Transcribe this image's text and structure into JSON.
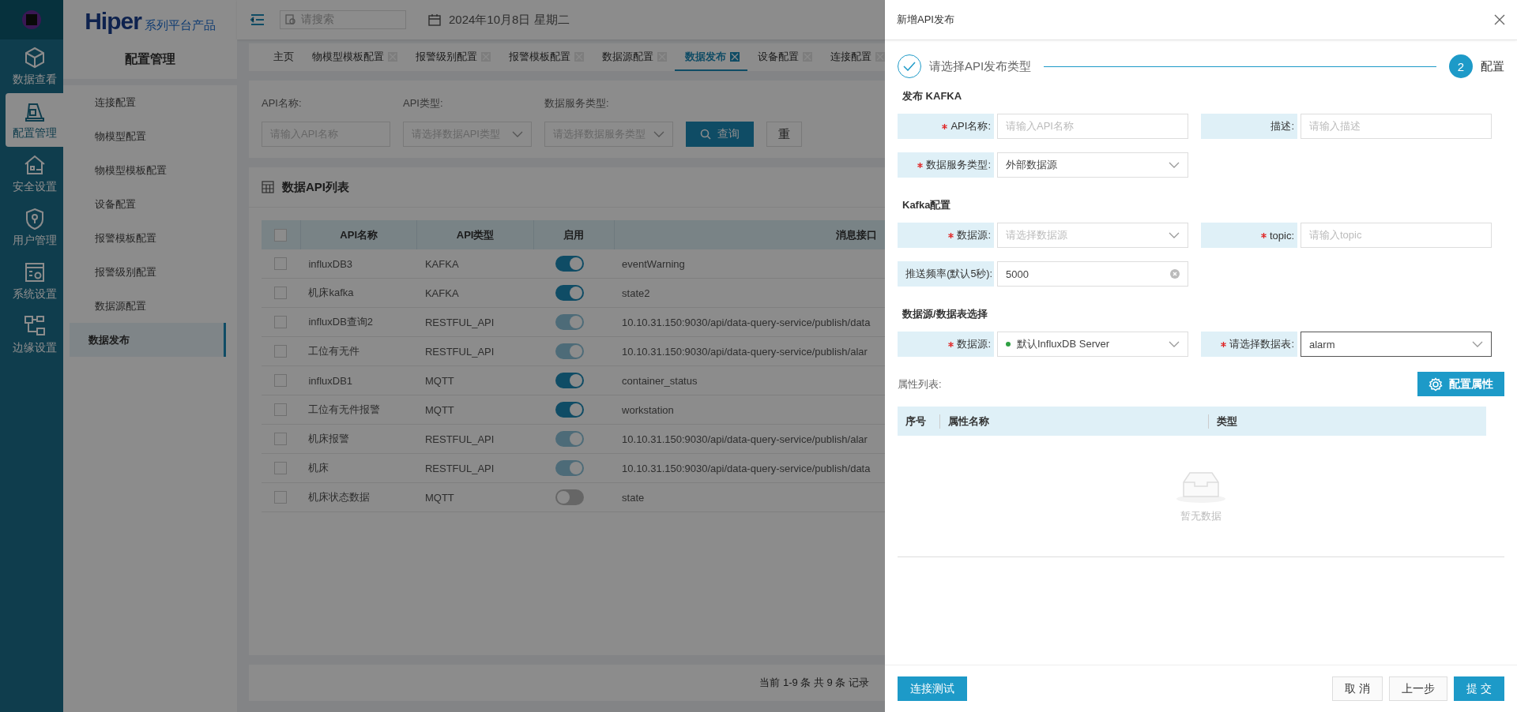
{
  "rail": {
    "items": [
      {
        "label": "数据查看",
        "selected": false
      },
      {
        "label": "配置管理",
        "selected": true
      },
      {
        "label": "安全设置",
        "selected": false
      },
      {
        "label": "用户管理",
        "selected": false
      },
      {
        "label": "系统设置",
        "selected": false
      },
      {
        "label": "边缘设置",
        "selected": false
      }
    ]
  },
  "brand": {
    "name": "Hiper",
    "tagline": "系列平台产品"
  },
  "header": {
    "search_placeholder": "请搜索",
    "date": "2024年10月8日 星期二"
  },
  "sidebar": {
    "title": "配置管理",
    "items": [
      {
        "label": "连接配置",
        "selected": false
      },
      {
        "label": "物模型配置",
        "selected": false
      },
      {
        "label": "物模型模板配置",
        "selected": false
      },
      {
        "label": "设备配置",
        "selected": false
      },
      {
        "label": "报警模板配置",
        "selected": false
      },
      {
        "label": "报警级别配置",
        "selected": false
      },
      {
        "label": "数据源配置",
        "selected": false
      },
      {
        "label": "数据发布",
        "selected": true
      }
    ]
  },
  "tabs": [
    {
      "label": "主页",
      "selected": false,
      "closable": false
    },
    {
      "label": "物模型模板配置",
      "selected": false,
      "closable": true
    },
    {
      "label": "报警级别配置",
      "selected": false,
      "closable": true
    },
    {
      "label": "报警模板配置",
      "selected": false,
      "closable": true
    },
    {
      "label": "数据源配置",
      "selected": false,
      "closable": true
    },
    {
      "label": "数据发布",
      "selected": true,
      "closable": true
    },
    {
      "label": "设备配置",
      "selected": false,
      "closable": true
    },
    {
      "label": "连接配置",
      "selected": false,
      "closable": true
    }
  ],
  "filters": {
    "fields": [
      {
        "label": "API名称:",
        "kind": "input",
        "placeholder": "请输入API名称"
      },
      {
        "label": "API类型:",
        "kind": "select",
        "placeholder": "请选择数据API类型"
      },
      {
        "label": "数据服务类型:",
        "kind": "select",
        "placeholder": "请选择数据服务类型"
      }
    ],
    "search_button": "查询",
    "reset_button": "重"
  },
  "api_list": {
    "title": "数据API列表",
    "select_all_checked": false,
    "columns": [
      "API名称",
      "API类型",
      "启用",
      "消息接口"
    ],
    "rows": [
      {
        "checked": false,
        "name": "influxDB3",
        "type": "KAFKA",
        "enabled": true,
        "disabled": false,
        "endpoint": "eventWarning"
      },
      {
        "checked": false,
        "name": "机床kafka",
        "type": "KAFKA",
        "enabled": true,
        "disabled": false,
        "endpoint": "state2"
      },
      {
        "checked": false,
        "name": "influxDB查询2",
        "type": "RESTFUL_API",
        "enabled": true,
        "disabled": true,
        "endpoint": "10.10.31.150:9030/api/data-query-service/publish/data"
      },
      {
        "checked": false,
        "name": "工位有无件",
        "type": "RESTFUL_API",
        "enabled": true,
        "disabled": true,
        "endpoint": "10.10.31.150:9030/api/data-query-service/publish/alar"
      },
      {
        "checked": false,
        "name": "influxDB1",
        "type": "MQTT",
        "enabled": true,
        "disabled": false,
        "endpoint": "container_status"
      },
      {
        "checked": false,
        "name": "工位有无件报警",
        "type": "MQTT",
        "enabled": true,
        "disabled": false,
        "endpoint": "workstation"
      },
      {
        "checked": false,
        "name": "机床报警",
        "type": "RESTFUL_API",
        "enabled": true,
        "disabled": true,
        "endpoint": "10.10.31.150:9030/api/data-query-service/publish/alar"
      },
      {
        "checked": false,
        "name": "机床",
        "type": "RESTFUL_API",
        "enabled": true,
        "disabled": true,
        "endpoint": "10.10.31.150:9030/api/data-query-service/publish/data"
      },
      {
        "checked": false,
        "name": "机床状态数据",
        "type": "MQTT",
        "enabled": false,
        "disabled": false,
        "endpoint": "state"
      }
    ]
  },
  "pager": {
    "summary": "当前 1-9 条 共 9 条 记录"
  },
  "drawer": {
    "title": "新增API发布",
    "steps": [
      {
        "label": "请选择API发布类型",
        "done": true
      },
      {
        "label": "配置",
        "number": "2",
        "done": false
      }
    ],
    "sections": [
      {
        "title": "发布 KAFKA",
        "rows": [
          [
            {
              "label": "API名称:",
              "required": true,
              "kind": "input",
              "placeholder": "请输入API名称"
            },
            {
              "label": "描述:",
              "required": false,
              "kind": "input",
              "placeholder": "请输入描述"
            }
          ],
          [
            {
              "label": "数据服务类型:",
              "required": true,
              "kind": "select",
              "value": "外部数据源"
            }
          ]
        ]
      },
      {
        "title": "Kafka配置",
        "rows": [
          [
            {
              "label": "数据源:",
              "required": true,
              "kind": "select",
              "placeholder": "请选择数据源"
            },
            {
              "label": "topic:",
              "required": true,
              "kind": "input",
              "placeholder": "请输入topic"
            }
          ],
          [
            {
              "label": "推送频率(默认5秒):",
              "required": false,
              "kind": "clearable",
              "value": "5000"
            }
          ]
        ]
      },
      {
        "title": "数据源/数据表选择",
        "rows": [
          [
            {
              "label": "数据源:",
              "required": true,
              "kind": "status-select",
              "value": "默认InfluxDB Server",
              "color": "#2ea043"
            },
            {
              "label": "请选择数据表:",
              "required": true,
              "kind": "select",
              "value": "alarm",
              "focused": true
            }
          ]
        ]
      }
    ],
    "attributes": {
      "label": "属性列表:",
      "button": "配置属性",
      "columns": [
        "序号",
        "属性名称",
        "类型"
      ],
      "empty_text": "暂无数据"
    },
    "footer": {
      "test_button": "连接测试",
      "cancel_button": "取 消",
      "prev_button": "上一步",
      "submit_button": "提 交"
    }
  }
}
